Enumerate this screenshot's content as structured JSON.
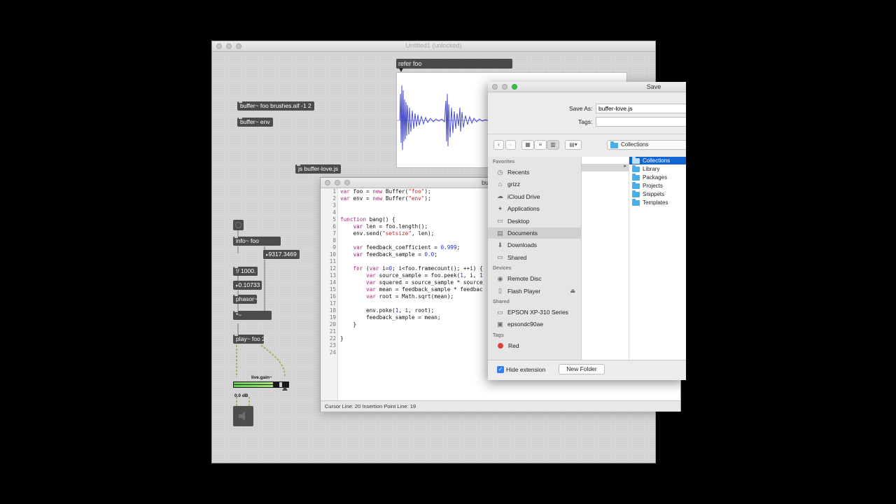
{
  "patcher": {
    "title": "Untitled1 (unlocked)",
    "objects": {
      "buffer_foo": "buffer~ foo brushes.aif -1 2",
      "buffer_env": "buffer~ env",
      "js_obj": "js buffer-love.js",
      "info": "info~ foo",
      "number_out": "9317.3469",
      "div": "!/ 1000.",
      "float_num": "0.10733",
      "phasor": "phasor~",
      "times": "*~",
      "play": "play~ foo 2",
      "gain_label": "live.gain~",
      "db_value": "0.0 dB"
    },
    "waveform": {
      "label": "refer foo"
    }
  },
  "editor": {
    "title": "bu",
    "code_lines": [
      {
        "n": "1",
        "html": "<span class='kw'>var</span> foo = <span class='kw'>new</span> Buffer(<span class='str'>\"foo\"</span>);"
      },
      {
        "n": "2",
        "html": "<span class='kw'>var</span> env = <span class='kw'>new</span> Buffer(<span class='str'>\"env\"</span>);"
      },
      {
        "n": "3",
        "html": ""
      },
      {
        "n": "4",
        "html": ""
      },
      {
        "n": "5",
        "html": "<span class='kw'>function</span> bang() {"
      },
      {
        "n": "6",
        "html": "    <span class='kw'>var</span> len = foo.length();"
      },
      {
        "n": "7",
        "html": "    env.send(<span class='str'>\"setsize\"</span>, len);"
      },
      {
        "n": "8",
        "html": ""
      },
      {
        "n": "9",
        "html": "    <span class='kw'>var</span> feedback_coefficient = <span class='num'>0.999</span>;"
      },
      {
        "n": "10",
        "html": "    <span class='kw'>var</span> feedback_sample = <span class='num'>0.0</span>;"
      },
      {
        "n": "11",
        "html": ""
      },
      {
        "n": "12",
        "html": "    <span class='kw'>for</span> (<span class='kw'>var</span> i=<span class='num'>0</span>; i&lt;foo.framecount(); ++i) {"
      },
      {
        "n": "13",
        "html": "        <span class='kw'>var</span> source_sample = foo.peek(<span class='num'>1</span>, i, <span class='num'>1</span>"
      },
      {
        "n": "14",
        "html": "        <span class='kw'>var</span> squared = source_sample * source"
      },
      {
        "n": "15",
        "html": "        <span class='kw'>var</span> mean = feedback_sample * feedbac"
      },
      {
        "n": "16",
        "html": "        <span class='kw'>var</span> root = Math.sqrt(mean);"
      },
      {
        "n": "17",
        "html": ""
      },
      {
        "n": "18",
        "html": "        env.poke(<span class='num'>1</span>, i, root);"
      },
      {
        "n": "19",
        "html": "        feedback_sample = mean;"
      },
      {
        "n": "20",
        "html": "    }"
      },
      {
        "n": "21",
        "html": ""
      },
      {
        "n": "22",
        "html": "}"
      },
      {
        "n": "23",
        "html": ""
      },
      {
        "n": "24",
        "html": ""
      }
    ],
    "status": "Cursor Line: 20    Insertion Point Line: 19"
  },
  "save_dialog": {
    "title": "Save",
    "save_as_label": "Save As:",
    "save_as_value": "buffer-love.js",
    "tags_label": "Tags:",
    "location": "Collections",
    "sidebar": {
      "favorites_header": "Favorites",
      "favorites": [
        {
          "label": "Recents",
          "icon": "clock-icon",
          "glyph": "◷"
        },
        {
          "label": "grizz",
          "icon": "home-icon",
          "glyph": "⌂"
        },
        {
          "label": "iCloud Drive",
          "icon": "cloud-icon",
          "glyph": "☁"
        },
        {
          "label": "Applications",
          "icon": "applications-icon",
          "glyph": "✦"
        },
        {
          "label": "Desktop",
          "icon": "desktop-icon",
          "glyph": "▭"
        },
        {
          "label": "Documents",
          "icon": "documents-icon",
          "glyph": "▤"
        },
        {
          "label": "Downloads",
          "icon": "downloads-icon",
          "glyph": "⬇"
        },
        {
          "label": "Shared",
          "icon": "shared-folder-icon",
          "glyph": "▭"
        }
      ],
      "devices_header": "Devices",
      "devices": [
        {
          "label": "Remote Disc",
          "icon": "disc-icon",
          "glyph": "◉"
        },
        {
          "label": "Flash Player",
          "icon": "drive-icon",
          "glyph": "▯"
        }
      ],
      "shared_header": "Shared",
      "shared": [
        {
          "label": "EPSON XP-310 Series",
          "icon": "printer-icon",
          "glyph": "▭"
        },
        {
          "label": "epsondc90ae",
          "icon": "computer-icon",
          "glyph": "▣"
        }
      ],
      "tags_header": "Tags",
      "tags": [
        {
          "label": "Red",
          "icon": "red-tag-icon",
          "color": "#e2403a"
        }
      ]
    },
    "column_items": [
      "Collections",
      "Library",
      "Packages",
      "Projects",
      "Snippets",
      "Templates"
    ],
    "hide_extension_label": "Hide extension",
    "new_folder_label": "New Folder"
  }
}
